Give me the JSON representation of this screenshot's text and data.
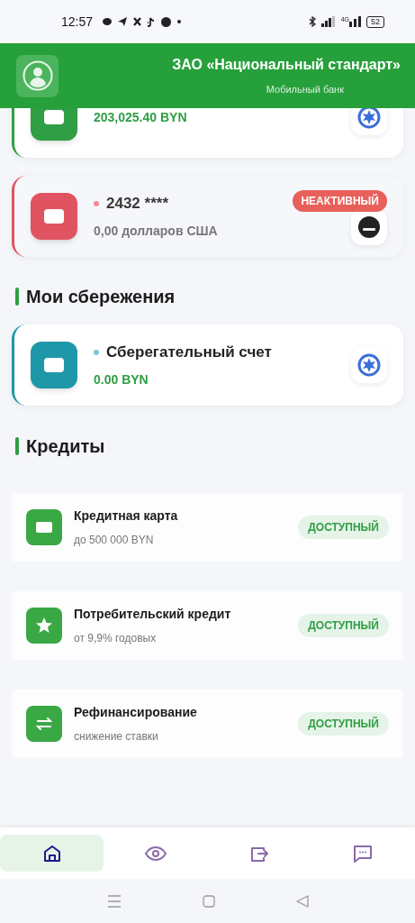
{
  "status_bar": {
    "time": "12:57",
    "network": "4G",
    "battery": "52"
  },
  "header": {
    "title": "ЗАО «Национальный стандарт»",
    "subtitle": "Мобильный банк"
  },
  "accounts": [
    {
      "amount": "203,025.40 BYN",
      "color": "#2f9e44",
      "active": true,
      "kind": "star"
    },
    {
      "name": "2432 ****",
      "amount": "0,00 долларов США",
      "color": "#e05462",
      "active": false,
      "badge": "НЕАКТИВНЫЙ",
      "kind": "visa"
    }
  ],
  "savings": {
    "title": "Мои сбережения",
    "accounts": [
      {
        "name": "Сберегательный счет",
        "amount": "0.00 BYN",
        "color": "#1e98a8",
        "active": true,
        "kind": "star"
      }
    ]
  },
  "credits": {
    "title": "Кредиты",
    "items": [
      {
        "kind": "card",
        "title": "Кредитная карта",
        "subtitle": "до 500 000 BYN",
        "badge": "ДОСТУПНЫЙ"
      },
      {
        "kind": "star",
        "title": "Потребительский кредит",
        "subtitle": "от 9,9% годовых",
        "badge": "ДОСТУПНЫЙ"
      },
      {
        "kind": "swap",
        "title": "Рефинансирование",
        "subtitle": "снижение ставки",
        "badge": "ДОСТУПНЫЙ"
      }
    ]
  },
  "bottom_nav": [
    {
      "kind": "home",
      "selected": true
    },
    {
      "kind": "eye",
      "selected": false
    },
    {
      "kind": "transfer",
      "selected": false
    },
    {
      "kind": "chat",
      "selected": false
    }
  ]
}
